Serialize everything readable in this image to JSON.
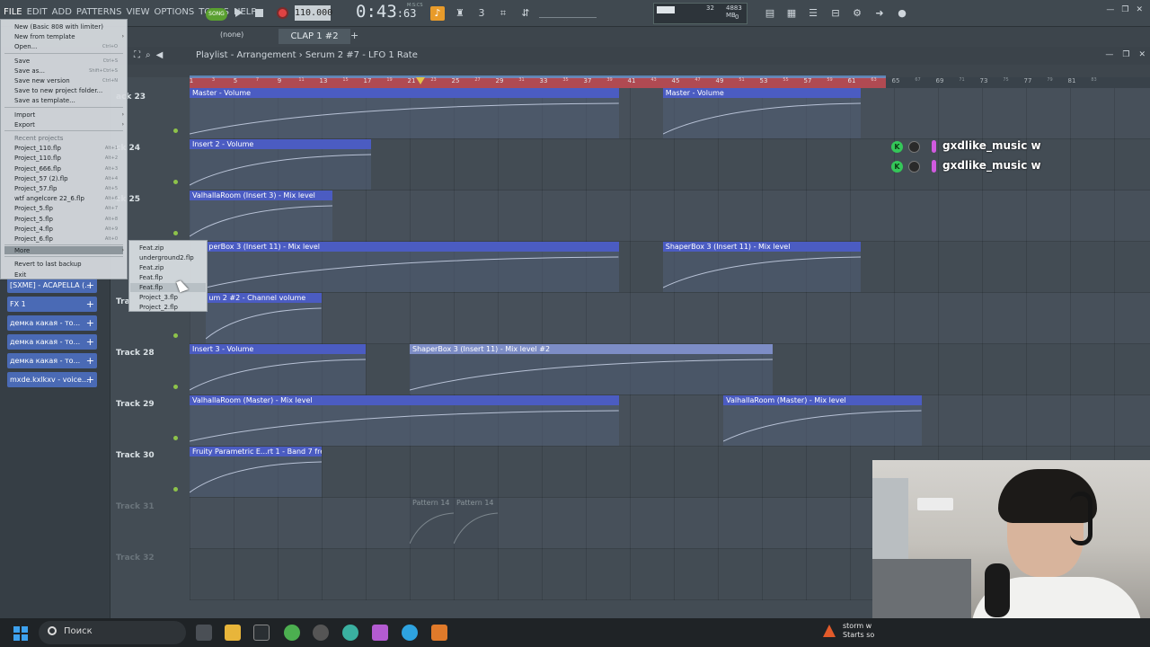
{
  "menu": [
    "FILE",
    "EDIT",
    "ADD",
    "PATTERNS",
    "VIEW",
    "OPTIONS",
    "TOOLS",
    "HELP"
  ],
  "transport": {
    "song_label": "SONG",
    "tempo": "110.000",
    "time": "0:43",
    "time_small": ":63",
    "time_unit": "M:S:CS"
  },
  "cpu": {
    "value1": "32",
    "memory": "4883 MB",
    "value3": "0"
  },
  "pattern": {
    "none_label": "(none)",
    "current": "CLAP 1 #2"
  },
  "playlist": {
    "title": "Playlist - Arrangement",
    "breadcrumb": "Serum 2 #7 - LFO 1 Rate"
  },
  "ruler": {
    "labels": [
      {
        "bar": 1,
        "v": "1"
      },
      {
        "bar": 3,
        "v": "3",
        "s": true
      },
      {
        "bar": 5,
        "v": "5"
      },
      {
        "bar": 7,
        "v": "7",
        "s": true
      },
      {
        "bar": 9,
        "v": "9"
      },
      {
        "bar": 11,
        "v": "11",
        "s": true
      },
      {
        "bar": 13,
        "v": "13"
      },
      {
        "bar": 15,
        "v": "15",
        "s": true
      },
      {
        "bar": 17,
        "v": "17"
      },
      {
        "bar": 19,
        "v": "19",
        "s": true
      },
      {
        "bar": 21,
        "v": "21"
      },
      {
        "bar": 23,
        "v": "23",
        "s": true
      },
      {
        "bar": 25,
        "v": "25"
      },
      {
        "bar": 27,
        "v": "27",
        "s": true
      },
      {
        "bar": 29,
        "v": "29"
      },
      {
        "bar": 31,
        "v": "31",
        "s": true
      },
      {
        "bar": 33,
        "v": "33"
      },
      {
        "bar": 35,
        "v": "35",
        "s": true
      },
      {
        "bar": 37,
        "v": "37"
      },
      {
        "bar": 39,
        "v": "39",
        "s": true
      },
      {
        "bar": 41,
        "v": "41"
      },
      {
        "bar": 43,
        "v": "43",
        "s": true
      },
      {
        "bar": 45,
        "v": "45"
      },
      {
        "bar": 47,
        "v": "47",
        "s": true
      },
      {
        "bar": 49,
        "v": "49"
      },
      {
        "bar": 51,
        "v": "51",
        "s": true
      },
      {
        "bar": 53,
        "v": "53"
      },
      {
        "bar": 55,
        "v": "55",
        "s": true
      },
      {
        "bar": 57,
        "v": "57"
      },
      {
        "bar": 59,
        "v": "59",
        "s": true
      },
      {
        "bar": 61,
        "v": "61"
      },
      {
        "bar": 63,
        "v": "63",
        "s": true
      },
      {
        "bar": 65,
        "v": "65"
      },
      {
        "bar": 67,
        "v": "67",
        "s": true
      },
      {
        "bar": 69,
        "v": "69"
      },
      {
        "bar": 71,
        "v": "71",
        "s": true
      },
      {
        "bar": 73,
        "v": "73"
      },
      {
        "bar": 75,
        "v": "75",
        "s": true
      },
      {
        "bar": 77,
        "v": "77"
      },
      {
        "bar": 79,
        "v": "79",
        "s": true
      },
      {
        "bar": 81,
        "v": "81"
      },
      {
        "bar": 83,
        "v": "83",
        "s": true
      }
    ]
  },
  "tracks": [
    {
      "label": "ack 23",
      "dim": false
    },
    {
      "label": "ck 24",
      "dim": false
    },
    {
      "label": "ck 25",
      "dim": false
    },
    {
      "label": "",
      "dim": false
    },
    {
      "label": "Tra",
      "dim": false
    },
    {
      "label": "Track 28",
      "dim": false
    },
    {
      "label": "Track 29",
      "dim": false
    },
    {
      "label": "Track 30",
      "dim": false
    },
    {
      "label": "Track 31",
      "dim": true
    },
    {
      "label": "Track 32",
      "dim": true
    }
  ],
  "clips": [
    {
      "name": "Master - Volume",
      "row": 0,
      "x": 1,
      "w": 39
    },
    {
      "name": "Master - Volume",
      "row": 0,
      "x": 44,
      "w": 18
    },
    {
      "name": "Insert 2 - Volume",
      "row": 1,
      "x": 1,
      "w": 16.5
    },
    {
      "name": "ValhallaRoom (Insert 3) - Mix level",
      "row": 2,
      "x": 1,
      "w": 13
    },
    {
      "name": "perBox 3 (Insert 11) - Mix level",
      "row": 3,
      "x": 2.5,
      "w": 37.5
    },
    {
      "name": "ShaperBox 3 (Insert 11) - Mix level",
      "row": 3,
      "x": 44,
      "w": 18
    },
    {
      "name": "um 2 #2 - Channel volume",
      "row": 4,
      "x": 2.5,
      "w": 10.5
    },
    {
      "name": "Insert 3 - Volume",
      "row": 5,
      "x": 1,
      "w": 16
    },
    {
      "name": "ShaperBox 3 (Insert 11) - Mix level #2",
      "row": 5,
      "x": 21,
      "w": 33,
      "light": true
    },
    {
      "name": "ValhallaRoom (Master) - Mix level",
      "row": 6,
      "x": 1,
      "w": 39
    },
    {
      "name": "ValhallaRoom (Master) - Mix level",
      "row": 6,
      "x": 49.5,
      "w": 18
    },
    {
      "name": "Fruity Parametric E...rt 1 - Band 7 freq",
      "row": 7,
      "x": 1,
      "w": 12
    },
    {
      "name": "Pattern 14",
      "row": 8,
      "x": 21,
      "w": 4,
      "faded": true
    },
    {
      "name": "Pattern 14",
      "row": 8,
      "x": 25,
      "w": 4,
      "faded": true
    }
  ],
  "browser": [
    {
      "label": "[SXME] - ACAPELLA (..."
    },
    {
      "label": "FX 1"
    },
    {
      "label": "демка какая - то..."
    },
    {
      "label": "демка какая - то..."
    },
    {
      "label": "демка какая - то..."
    },
    {
      "label": "mxde.kxlkxv - voice..."
    }
  ],
  "file_menu": {
    "items": [
      {
        "label": "New (Basic 808 with limiter)",
        "shortcut": ""
      },
      {
        "label": "New from template",
        "shortcut": "",
        "sub": true
      },
      {
        "label": "Open...",
        "shortcut": "Ctrl+O"
      },
      {
        "label": "Save",
        "shortcut": "Ctrl+S"
      },
      {
        "label": "Save as...",
        "shortcut": "Shift+Ctrl+S"
      },
      {
        "label": "Save new version",
        "shortcut": "Ctrl+N"
      },
      {
        "label": "Save to new project folder...",
        "shortcut": ""
      },
      {
        "label": "Save as template...",
        "shortcut": ""
      },
      {
        "label": "Import",
        "shortcut": "",
        "sub": true
      },
      {
        "label": "Export",
        "shortcut": "",
        "sub": true
      },
      {
        "label": "Recent projects",
        "shortcut": "",
        "muted": true
      },
      {
        "label": "Project_110.flp",
        "shortcut": "Alt+1"
      },
      {
        "label": "Project_110.flp",
        "shortcut": "Alt+2"
      },
      {
        "label": "Project_666.flp",
        "shortcut": "Alt+3"
      },
      {
        "label": "Project_57 (2).flp",
        "shortcut": "Alt+4"
      },
      {
        "label": "Project_57.flp",
        "shortcut": "Alt+5"
      },
      {
        "label": "wtf angelcore 22_6.flp",
        "shortcut": "Alt+6"
      },
      {
        "label": "Project_5.flp",
        "shortcut": "Alt+7"
      },
      {
        "label": "Project_5.flp",
        "shortcut": "Alt+8"
      },
      {
        "label": "Project_4.flp",
        "shortcut": "Alt+9"
      },
      {
        "label": "Project_6.flp",
        "shortcut": "Alt+0"
      },
      {
        "label": "More",
        "shortcut": "",
        "sub": true,
        "highlight": true
      },
      {
        "label": "Revert to last backup",
        "shortcut": ""
      },
      {
        "label": "Exit",
        "shortcut": ""
      }
    ]
  },
  "more_submenu": [
    "Feat.zip",
    "underground2.flp",
    "Feat.zip",
    "Feat.flp",
    "Feat.flp",
    "Project_3.flp",
    "Project_2.flp"
  ],
  "overlay_users": [
    "gxdlike_music w",
    "gxdlike_music w"
  ],
  "taskbar": {
    "search_placeholder": "Поиск",
    "weather_line1": "storm w",
    "weather_line2": "Starts so"
  },
  "colors": {
    "clip_header": "#4b5cc2",
    "loop_region": "#b04a52",
    "accent_orange": "#e89b2a"
  }
}
